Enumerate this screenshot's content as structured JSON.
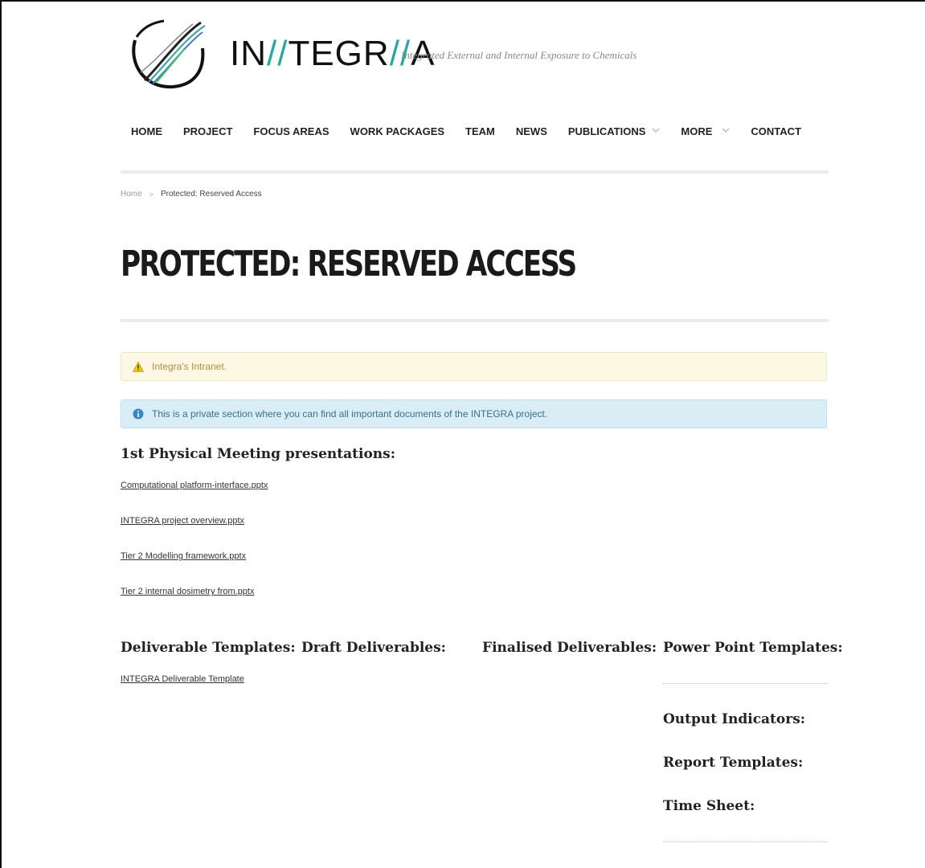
{
  "site": {
    "logo_text_parts": [
      "IN",
      "//",
      "TEGR",
      "//",
      "A"
    ],
    "tagline": "Integrated External and Internal Exposure to Chemicals",
    "brand_color": "#2aa7a0"
  },
  "nav": {
    "items": [
      {
        "label": "HOME",
        "dropdown": false
      },
      {
        "label": "PROJECT",
        "dropdown": false
      },
      {
        "label": "FOCUS AREAS",
        "dropdown": false
      },
      {
        "label": "WORK PACKAGES",
        "dropdown": false
      },
      {
        "label": "TEAM",
        "dropdown": false
      },
      {
        "label": "NEWS",
        "dropdown": false
      },
      {
        "label": "PUBLICATIONS",
        "dropdown": true
      },
      {
        "label": "MORE",
        "dropdown": true
      },
      {
        "label": "CONTACT",
        "dropdown": false
      }
    ]
  },
  "breadcrumb": {
    "home": "Home",
    "current": "Protected: Reserved Access"
  },
  "page": {
    "title": "PROTECTED: RESERVED ACCESS"
  },
  "alerts": {
    "warning": "Integra's Intranet.",
    "info": "This is a private section where you can find all important documents of the INTEGRA project."
  },
  "meeting": {
    "heading": "1st Physical Meeting presentations:",
    "links": [
      "Computational platform-interface.pptx",
      "INTEGRA project overview.pptx",
      "Tier 2 Modelling framework.pptx",
      "Tier 2 internal dosimetry from.pptx"
    ]
  },
  "columns": {
    "deliverable_templates": {
      "heading": "Deliverable Templates:",
      "links": [
        "INTEGRA Deliverable Template"
      ]
    },
    "draft_deliverables": {
      "heading": "Draft Deliverables:"
    },
    "finalised_deliverables": {
      "heading": "Finalised Deliverables:"
    },
    "power_point_templates": {
      "heading": "Power Point Templates:"
    },
    "output_indicators": {
      "heading": "Output Indicators:"
    },
    "report_templates": {
      "heading": "Report Templates:"
    },
    "time_sheet": {
      "heading": "Time Sheet:"
    }
  }
}
